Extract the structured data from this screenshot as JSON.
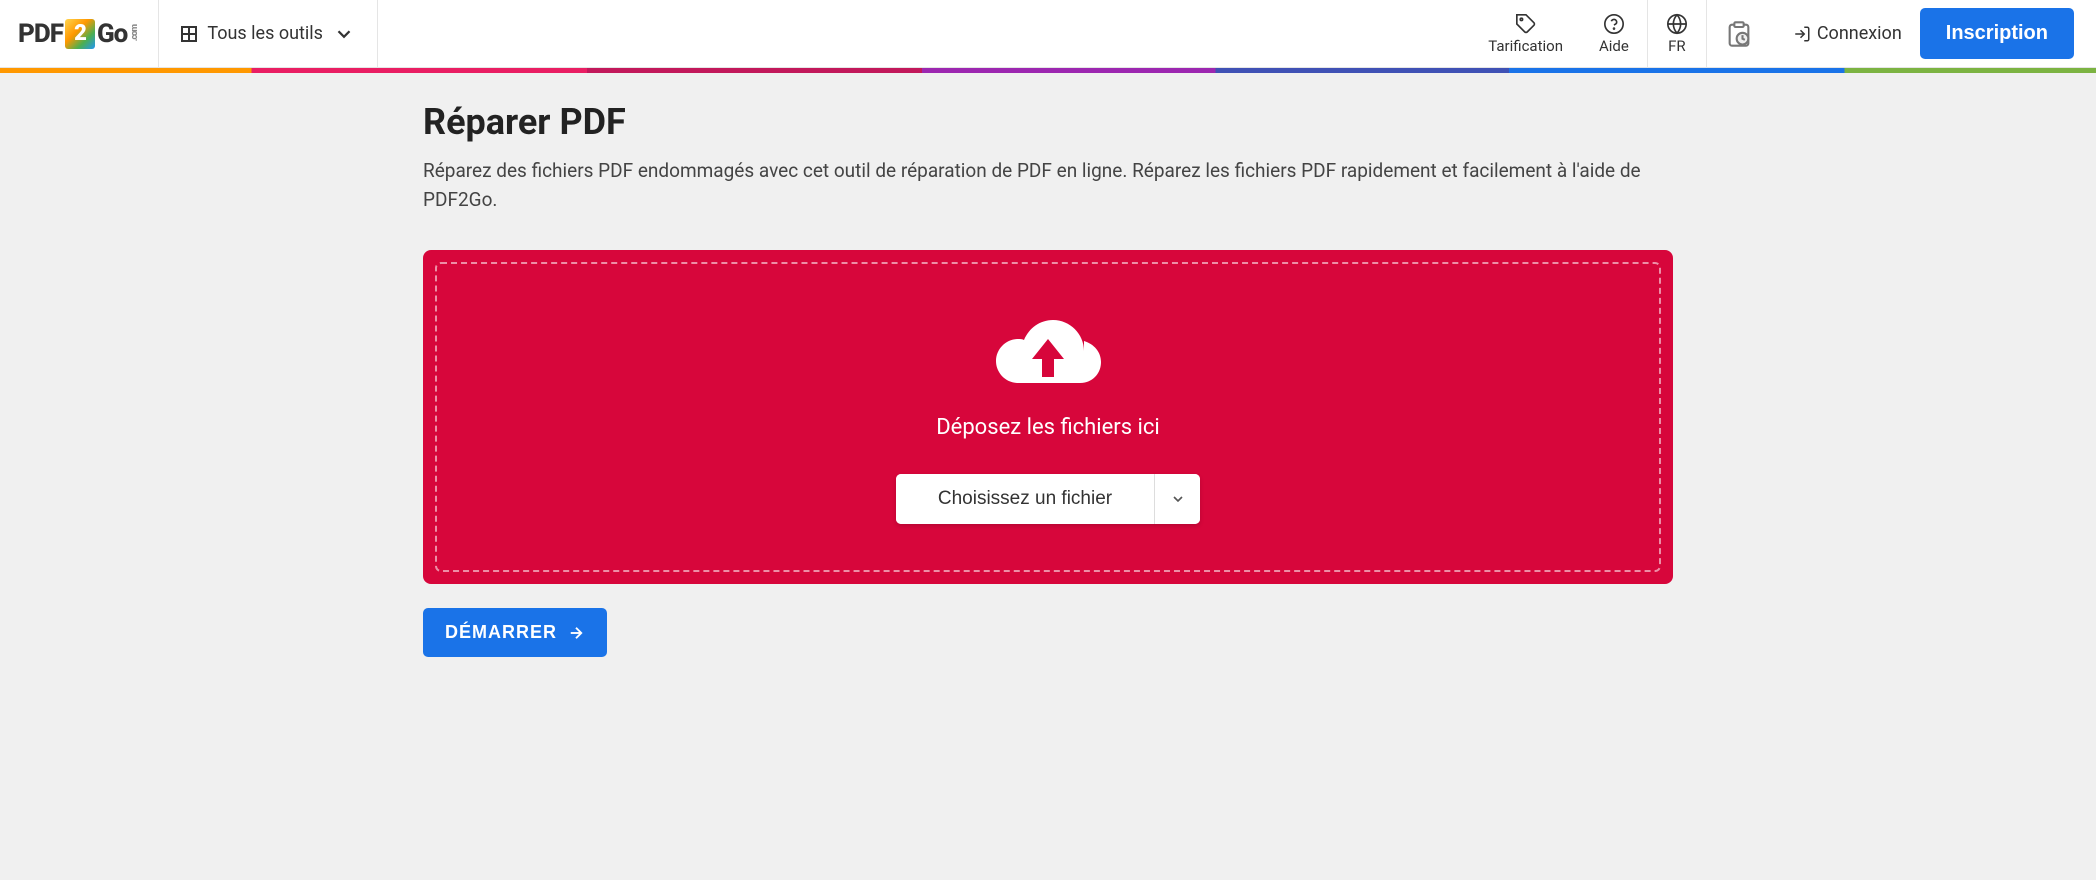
{
  "header": {
    "logo_pre": "PDF",
    "logo_mid": "2",
    "logo_post": "Go",
    "logo_suffix": ".com",
    "tools_label": "Tous les outils",
    "pricing": "Tarification",
    "help": "Aide",
    "lang": "FR",
    "login": "Connexion",
    "signup": "Inscription"
  },
  "page": {
    "title": "Réparer PDF",
    "subtitle": "Réparez des fichiers PDF endommagés avec cet outil de réparation de PDF en ligne. Réparez les fichiers PDF rapidement et facilement à l'aide de PDF2Go."
  },
  "dropzone": {
    "drop_text": "Déposez les fichiers ici",
    "choose_file": "Choisissez un fichier"
  },
  "action": {
    "start": "DÉMARRER"
  }
}
